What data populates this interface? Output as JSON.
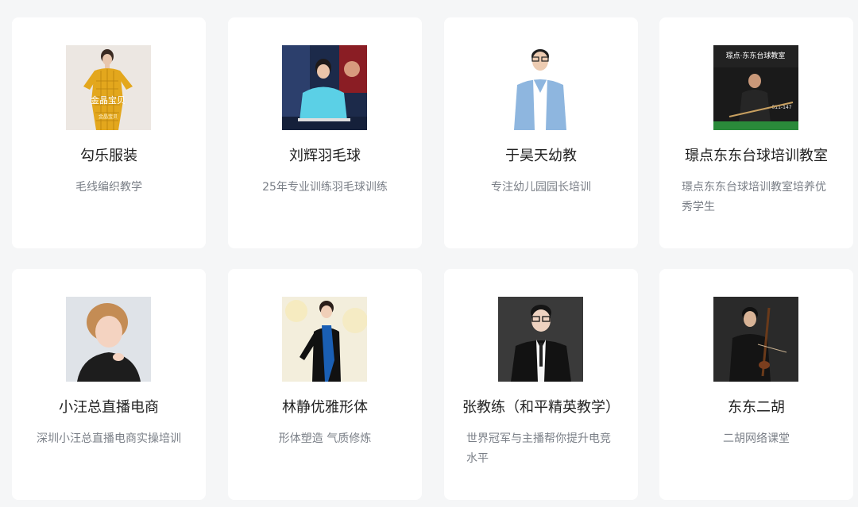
{
  "teachers": [
    {
      "name": "勾乐服装",
      "desc": "毛线编织教学",
      "photo": "woman-yellow-dress-photo",
      "photo_text": "金晶宝贝",
      "photo_text2": "金晶宝贝"
    },
    {
      "name": "刘辉羽毛球",
      "desc": "25年专业训练羽毛球训练",
      "photo": "badminton-coach-photo"
    },
    {
      "name": "于昊天幼教",
      "desc": "专注幼儿园园长培训",
      "photo": "man-blue-suit-photo"
    },
    {
      "name": "璟点东东台球培训教室",
      "desc": "璟点东东台球培训教室培养优秀学生",
      "photo": "billiards-coach-photo",
      "photo_text": "璟点·东东台球教室",
      "photo_text2": "011-147"
    },
    {
      "name": "小汪总直播电商",
      "desc": "深圳小汪总直播电商实操培训",
      "photo": "woman-short-hair-photo"
    },
    {
      "name": "林静优雅形体",
      "desc": "形体塑造 气质修炼",
      "photo": "woman-black-dress-photo"
    },
    {
      "name": "张教练（和平精英教学）",
      "desc": "世界冠军与主播帮你提升电竞水平",
      "photo": "man-glasses-suit-photo"
    },
    {
      "name": "东东二胡",
      "desc": "二胡网络课堂",
      "photo": "erhu-player-photo"
    }
  ],
  "colors": {
    "background": "#f5f6f7",
    "card": "#ffffff",
    "name_text": "#222222",
    "desc_text": "#7a7f87"
  }
}
